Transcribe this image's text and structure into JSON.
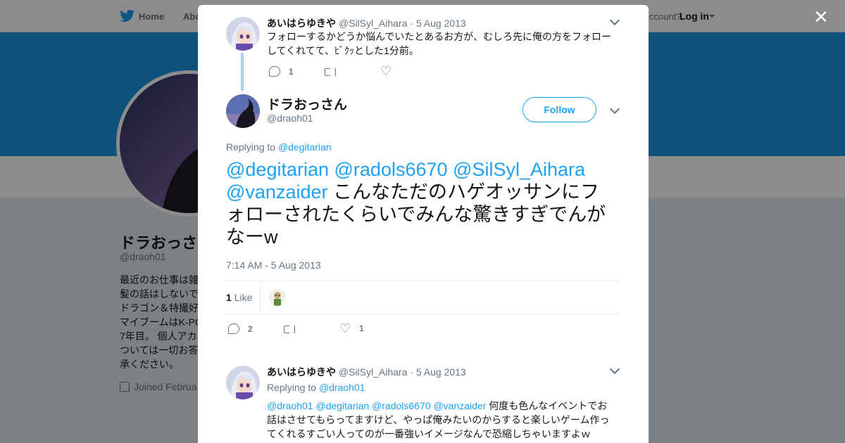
{
  "nav": {
    "home_label": "Home",
    "about_label": "Abo",
    "account_prompt": "ccount?",
    "login_label": "Log in"
  },
  "profile": {
    "name": "ドラおっさ",
    "handle": "@draoh01",
    "bio": "最近のお仕事は雑\n髪の話はしないで\nドラゴン＆特撮好\nマイブームはK-PO\n7年目。 個人アカ\nついては一切お答\n承ください。",
    "joined": "Joined Februa"
  },
  "thread": {
    "prev_tweet": {
      "name": "あいはらゆきや",
      "handle": "@SilSyl_Aihara",
      "date": "5 Aug 2013",
      "text": "フォローするかどうか悩んでいたとあるお方が、むしろ先に俺の方をフォローしてくれてて、ﾋﾞｸｯとした1分前。",
      "reply_count": "1"
    },
    "main_tweet": {
      "name": "ドラおっさん",
      "handle": "@draoh01",
      "follow_label": "Follow",
      "replying_prefix": "Replying to",
      "replying_to": "@degitarian",
      "mentions": [
        "@degitarian",
        "@radols6670",
        "@SilSyl_Aihara",
        "@vanzaider"
      ],
      "text": "こんなただのハゲオッサンにフォローされたくらいでみんな驚きすぎでんがなーw",
      "time": "7:14 AM - 5 Aug 2013",
      "like_count": "1",
      "like_label": "Like",
      "reply_count": "2",
      "like_action_count": "1"
    },
    "reply_tweet": {
      "name": "あいはらゆきや",
      "handle": "@SilSyl_Aihara",
      "date": "5 Aug 2013",
      "replying_prefix": "Replying to",
      "replying_to": "@draoh01",
      "mentions": [
        "@draoh01",
        "@degitarian",
        "@radols6670",
        "@vanzaider"
      ],
      "text": "何度も色んなイベントでお話はさせてもらってますけど、やっぱ俺みたいのからすると楽しいゲーム作ってくれるすごい人ってのが一番強いイメージなんで恐縮しちゃいますよｗ"
    }
  },
  "colors": {
    "accent": "#1da1f2",
    "banner": "#1b95e0",
    "thread_line": "#aad1f0"
  }
}
